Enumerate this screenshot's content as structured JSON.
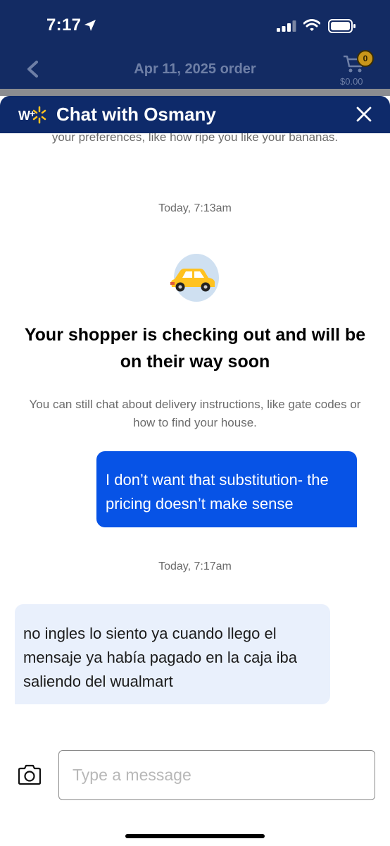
{
  "status_bar": {
    "time": "7:17",
    "icons": [
      "location-arrow-icon",
      "signal-icon",
      "wifi-icon",
      "battery-icon"
    ]
  },
  "order_header": {
    "title": "Apr 11, 2025 order",
    "cart_count": "0",
    "cart_total": "$0.00",
    "icons": [
      "chevron-left-icon",
      "cart-icon"
    ]
  },
  "chat_header": {
    "title": "Chat with Osmany",
    "icons": [
      "walmart-plus-icon",
      "close-icon"
    ]
  },
  "conversation": {
    "faded_intro": "your preferences, like how ripe you like your bananas.",
    "timestamp_1": "Today, 7:13am",
    "status_icon": "car-icon",
    "status_heading": "Your shopper is checking out and will be on their way soon",
    "status_subtext": "You can still chat about delivery instructions, like gate codes or how to find your house.",
    "timestamp_2": "Today, 7:17am",
    "messages": [
      {
        "from": "customer",
        "text": "I don’t want that substitution- the pricing doesn’t make sense"
      },
      {
        "from": "shopper",
        "text": "no ingles lo siento ya cuando llego el mensaje ya había pagado en la caja iba saliendo del wualmart"
      }
    ]
  },
  "composer": {
    "placeholder": "Type a message",
    "value": "",
    "icons": [
      "camera-icon"
    ]
  },
  "colors": {
    "header_bg": "#132b63",
    "chat_header_bg": "#0e2a6a",
    "outgoing_bubble": "#0753e6",
    "incoming_bubble": "#e9f0fc",
    "spark_yellow": "#ffc220"
  }
}
